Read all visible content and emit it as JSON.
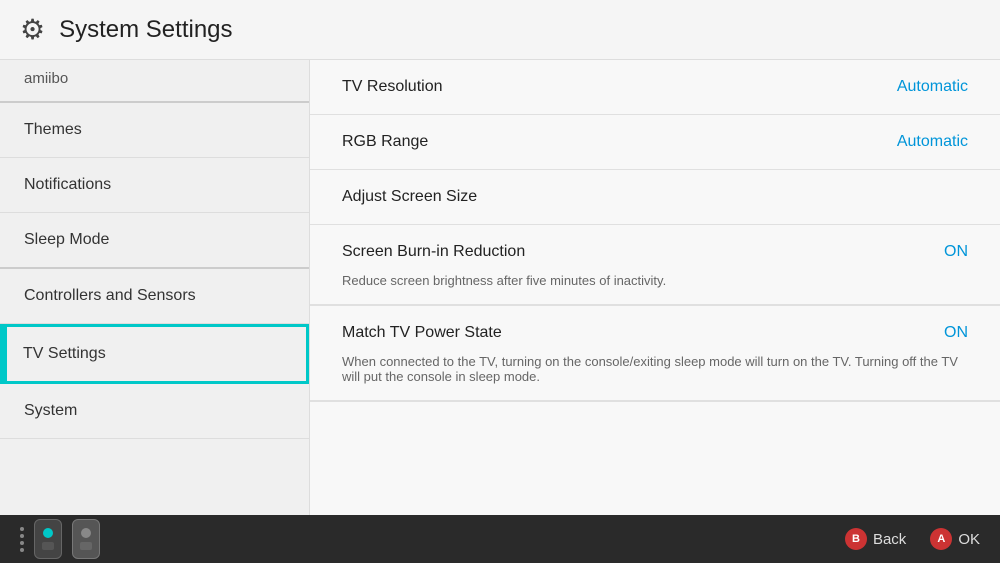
{
  "header": {
    "title": "System Settings",
    "icon": "⚙"
  },
  "sidebar": {
    "amiibo_label": "amiibo",
    "items": [
      {
        "id": "themes",
        "label": "Themes",
        "active": false,
        "separator_after": false
      },
      {
        "id": "notifications",
        "label": "Notifications",
        "active": false,
        "separator_after": false
      },
      {
        "id": "sleep-mode",
        "label": "Sleep Mode",
        "active": false,
        "separator_after": true
      },
      {
        "id": "controllers-sensors",
        "label": "Controllers and Sensors",
        "active": false,
        "separator_after": false
      },
      {
        "id": "tv-settings",
        "label": "TV Settings",
        "active": true,
        "separator_after": false
      },
      {
        "id": "system",
        "label": "System",
        "active": false,
        "separator_after": false
      }
    ]
  },
  "content": {
    "settings": [
      {
        "id": "tv-resolution",
        "label": "TV Resolution",
        "value": "Automatic",
        "description": null,
        "type": "value"
      },
      {
        "id": "rgb-range",
        "label": "RGB Range",
        "value": "Automatic",
        "description": null,
        "type": "value"
      },
      {
        "id": "adjust-screen-size",
        "label": "Adjust Screen Size",
        "value": null,
        "description": null,
        "type": "action"
      },
      {
        "id": "screen-burn-in",
        "label": "Screen Burn-in Reduction",
        "value": "ON",
        "description": "Reduce screen brightness after five minutes of inactivity.",
        "type": "toggle"
      },
      {
        "id": "match-tv-power",
        "label": "Match TV Power State",
        "value": "ON",
        "description": "When connected to the TV, turning on the console/exiting sleep mode will turn on the TV. Turning off the TV will put the console in sleep mode.",
        "type": "toggle"
      }
    ]
  },
  "bottom_bar": {
    "back_label": "Back",
    "ok_label": "OK",
    "back_button": "B",
    "ok_button": "A"
  }
}
